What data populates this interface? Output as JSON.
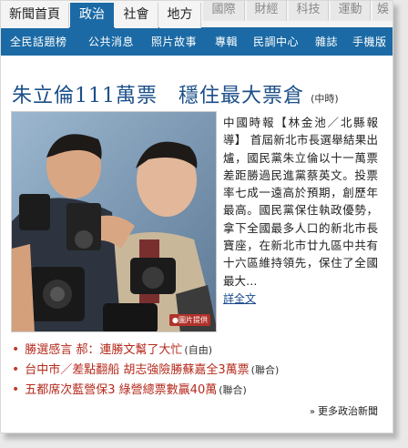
{
  "tabs": [
    {
      "label": "新聞首頁"
    },
    {
      "label": "政治"
    },
    {
      "label": "社會"
    },
    {
      "label": "地方"
    },
    {
      "label": "國際"
    },
    {
      "label": "財經"
    },
    {
      "label": "科技"
    },
    {
      "label": "運動"
    },
    {
      "label": "娛"
    }
  ],
  "subnav": [
    {
      "label": "全民話題榜"
    },
    {
      "label": "公共消息"
    },
    {
      "label": "照片故事"
    },
    {
      "label": "專輯"
    },
    {
      "label": "民調中心"
    },
    {
      "label": "雜誌"
    },
    {
      "label": "手機版"
    }
  ],
  "headline": {
    "title": "朱立倫111萬票　穩住最大票倉",
    "source": "(中時)"
  },
  "photo": {
    "credit": "●圖片提供"
  },
  "story": {
    "body": "中國時報【林金池／北縣報導】 首屆新北市長選舉結果出爐，國民黨朱立倫以十一萬票差距勝過民進黨蔡英文。投票率七成一遠高於預期，創歷年最高。國民黨保住執政優勢，拿下全國最多人口的新北市長寶座，在新北市廿九區中共有十六區維持領先，保住了全國最大…",
    "more": "詳全文"
  },
  "news": [
    {
      "title": "勝選感言 郝：連勝文幫了大忙",
      "source": "(自由)"
    },
    {
      "title": "台中市／差點翻船 胡志強險勝蘇嘉全3萬票",
      "source": "(聯合)"
    },
    {
      "title": "五都席次藍營保3 綠營總票數贏40萬",
      "source": "(聯合)"
    }
  ],
  "more_news": "更多政治新聞",
  "colors": {
    "brand_blue": "#1b6aa5",
    "headline_blue": "#1b4f88",
    "link_red": "#b52a1c"
  }
}
